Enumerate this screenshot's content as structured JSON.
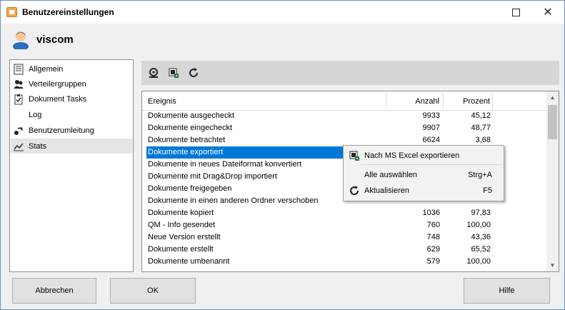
{
  "window": {
    "title": "Benutzereinstellungen",
    "maximize_glyph": "□",
    "close_glyph": "✕"
  },
  "user": {
    "name": "viscom"
  },
  "nav": {
    "items": [
      {
        "label": "Allgemein",
        "icon": "list-icon"
      },
      {
        "label": "Verteilergruppen",
        "icon": "users-icon"
      },
      {
        "label": "Dokument Tasks",
        "icon": "checklist-icon"
      },
      {
        "label": "Log",
        "icon": ""
      },
      {
        "label": "Benutzerumleitung",
        "icon": "redirect-icon"
      },
      {
        "label": "Stats",
        "icon": "chart-icon"
      }
    ],
    "selected": "Stats"
  },
  "toolbar": {
    "buttons": [
      {
        "icon": "gear-icon"
      },
      {
        "icon": "excel-export-icon"
      },
      {
        "icon": "refresh-icon"
      }
    ]
  },
  "grid": {
    "columns": [
      "Ereignis",
      "Anzahl",
      "Prozent"
    ],
    "rows": [
      {
        "ereignis": "Dokumente ausgecheckt",
        "anzahl": "9933",
        "prozent": "45,12"
      },
      {
        "ereignis": "Dokumente eingecheckt",
        "anzahl": "9907",
        "prozent": "48,77"
      },
      {
        "ereignis": "Dokumente betrachtet",
        "anzahl": "6624",
        "prozent": "3,68"
      },
      {
        "ereignis": "Dokumente exportiert",
        "anzahl": "",
        "prozent": ""
      },
      {
        "ereignis": "Dokumente in neues Dateiformat konvertiert",
        "anzahl": "",
        "prozent": ""
      },
      {
        "ereignis": "Dokumente mit Drag&Drop importiert",
        "anzahl": "",
        "prozent": ""
      },
      {
        "ereignis": "Dokumente freigegeben",
        "anzahl": "",
        "prozent": ""
      },
      {
        "ereignis": "Dokumente in einen anderen Ordner verschoben",
        "anzahl": "",
        "prozent": ""
      },
      {
        "ereignis": "Dokumente kopiert",
        "anzahl": "1036",
        "prozent": "97,83"
      },
      {
        "ereignis": "QM - Info gesendet",
        "anzahl": "760",
        "prozent": "100,00"
      },
      {
        "ereignis": "Neue Version erstellt",
        "anzahl": "748",
        "prozent": "43,36"
      },
      {
        "ereignis": "Dokumente erstellt",
        "anzahl": "629",
        "prozent": "65,52"
      },
      {
        "ereignis": "Dokumente umbenannt",
        "anzahl": "579",
        "prozent": "100,00"
      }
    ],
    "selected_row": "Dokumente exportiert"
  },
  "context_menu": {
    "items": [
      {
        "label": "Nach MS Excel exportieren",
        "shortcut": "",
        "icon": "excel-export-icon"
      },
      {
        "label": "Alle auswählen",
        "shortcut": "Strg+A",
        "icon": ""
      },
      {
        "label": "Aktualisieren",
        "shortcut": "F5",
        "icon": "refresh-icon"
      }
    ]
  },
  "buttons": {
    "cancel": "Abbrechen",
    "ok": "OK",
    "help": "Hilfe"
  },
  "colors": {
    "selection": "#0078d7",
    "toolbar_bg": "#d6d6d6",
    "window_bg": "#f0f0f0"
  }
}
